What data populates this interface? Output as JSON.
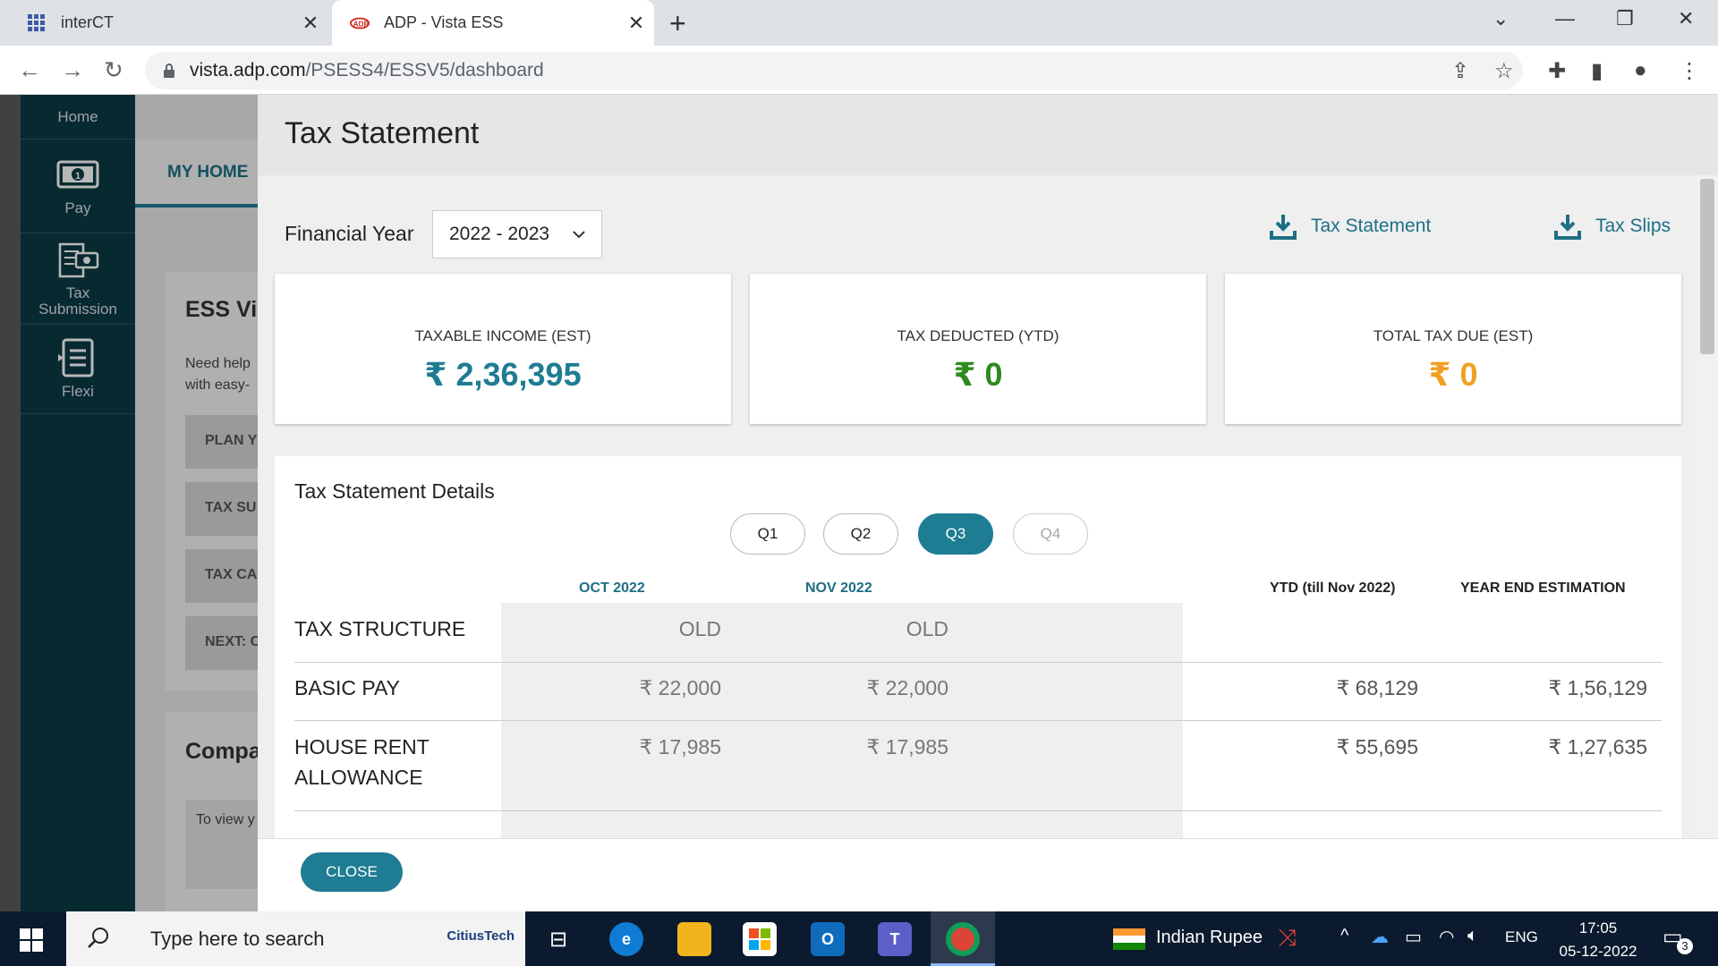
{
  "browser": {
    "tabs": [
      {
        "title": "interCT",
        "close": "✕"
      },
      {
        "title": "ADP - Vista ESS",
        "close": "✕"
      }
    ],
    "new_tab": "+",
    "url_host": "vista.adp.com",
    "url_path": "/PSESS4/ESSV5/dashboard"
  },
  "sidenav": {
    "items": [
      {
        "label": "Home",
        "icon": "home"
      },
      {
        "label": "Pay",
        "icon": "cash-icon"
      },
      {
        "label": "Tax Submission",
        "icon": "tax-doc-icon"
      },
      {
        "label": "Flexi",
        "icon": "list-icon"
      }
    ]
  },
  "background": {
    "nav_tab": "MY HOME",
    "card1_title": "ESS Vi",
    "card1_text1": "Need help",
    "card1_text2": "with easy-",
    "buttons": [
      "PLAN Y",
      "TAX SU",
      "TAX CA",
      "NEXT: C"
    ],
    "card2_title": "Compa",
    "card2_text": "To view y"
  },
  "modal": {
    "title": "Tax Statement",
    "fy_label": "Financial Year",
    "fy_value": "2022 - 2023",
    "download_links": [
      "Tax Statement",
      "Tax Slips"
    ],
    "summary": [
      {
        "label": "TAXABLE INCOME (EST)",
        "value": "₹ 2,36,395",
        "color": "#1e7c93"
      },
      {
        "label": "TAX DEDUCTED (YTD)",
        "value": "₹ 0",
        "color": "#2e8b1e"
      },
      {
        "label": "TOTAL TAX DUE (EST)",
        "value": "₹ 0",
        "color": "#f0a020"
      }
    ],
    "details_title": "Tax Statement Details",
    "quarters": [
      {
        "label": "Q1",
        "state": "normal"
      },
      {
        "label": "Q2",
        "state": "normal"
      },
      {
        "label": "Q3",
        "state": "active"
      },
      {
        "label": "Q4",
        "state": "disabled"
      }
    ],
    "columns": [
      "OCT 2022",
      "NOV 2022",
      "YTD (till Nov 2022)",
      "YEAR END ESTIMATION"
    ],
    "rows": [
      {
        "label": "TAX STRUCTURE",
        "oct": "OLD",
        "nov": "OLD",
        "ytd": "",
        "year_end": ""
      },
      {
        "label": "BASIC PAY",
        "oct": "₹ 22,000",
        "nov": "₹ 22,000",
        "ytd": "₹ 68,129",
        "year_end": "₹ 1,56,129"
      },
      {
        "label": "HOUSE RENT ALLOWANCE",
        "oct": "₹ 17,985",
        "nov": "₹ 17,985",
        "ytd": "₹ 55,695",
        "year_end": "₹ 1,27,635"
      }
    ],
    "close_label": "CLOSE"
  },
  "taskbar": {
    "search_placeholder": "Type here to search",
    "search_brand": "CitiusTech",
    "currency_widget": "Indian Rupee",
    "language": "ENG",
    "time": "17:05",
    "date": "05-12-2022",
    "notification_count": "3"
  }
}
